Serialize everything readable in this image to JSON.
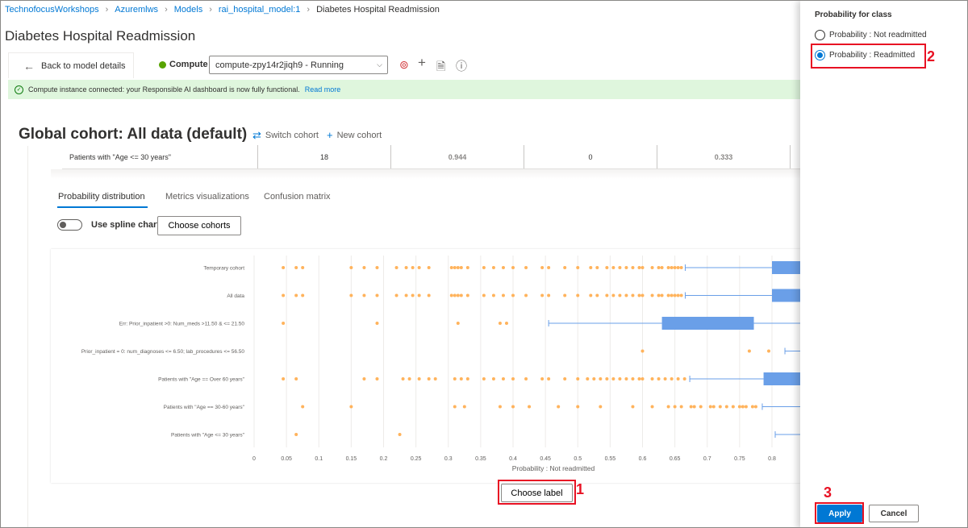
{
  "breadcrumb": [
    "TechnofocusWorkshops",
    "Azuremlws",
    "Models",
    "rai_hospital_model:1",
    "Diabetes Hospital Readmission"
  ],
  "page_title": "Diabetes Hospital Readmission",
  "toolbar": {
    "back_label": "Back to model details",
    "compute_label": "Compute",
    "compute_value": "compute-zpy14r2jiqh9 - Running",
    "status_color": "#57a300"
  },
  "info_bar": {
    "text": "Compute instance connected: your Responsible AI dashboard is now fully functional.",
    "link": "Read more"
  },
  "cohort": {
    "title": "Global cohort: All data (default)",
    "switch_label": "Switch cohort",
    "new_label": "New cohort"
  },
  "table_row": {
    "name": "Patients with \"Age <= 30 years\"",
    "values": [
      "18",
      "0.944",
      "0",
      "0.333"
    ]
  },
  "tabs": [
    "Probability distribution",
    "Metrics visualizations",
    "Confusion matrix"
  ],
  "controls": {
    "spline_label": "Use spline chart",
    "choose_cohorts": "Choose cohorts",
    "choose_label": "Choose label"
  },
  "chart_data": {
    "type": "box",
    "xlabel": "Probability : Not readmitted",
    "xlim": [
      0,
      0.8
    ],
    "x_ticks": [
      0,
      0.05,
      0.1,
      0.15,
      0.2,
      0.25,
      0.3,
      0.35,
      0.4,
      0.45,
      0.5,
      0.55,
      0.6,
      0.65,
      0.7,
      0.75,
      0.8
    ],
    "outlier_color": "#ffb35c",
    "box_color": "#6a9fe8",
    "categories": [
      "Temporary cohort",
      "All data",
      "Err: Prior_inpatient >0: Num_meds >11.50 & <= 21.50",
      "Prior_inpatient = 0: num_diagnoses <= 6.50; lab_procedures <= 56.50",
      "Patients with \"Age == Over 60 years\"",
      "Patients with \"Age == 30-60 years\"",
      "Patients with \"Age <= 30 years\""
    ],
    "series": [
      {
        "whisker_low": 0.666,
        "box_q1": 0.8,
        "box_q3": null,
        "outliers": [
          0.045,
          0.065,
          0.075,
          0.15,
          0.17,
          0.19,
          0.22,
          0.235,
          0.245,
          0.255,
          0.27,
          0.305,
          0.31,
          0.315,
          0.32,
          0.33,
          0.355,
          0.37,
          0.385,
          0.4,
          0.42,
          0.445,
          0.455,
          0.48,
          0.5,
          0.52,
          0.53,
          0.545,
          0.555,
          0.565,
          0.575,
          0.585,
          0.595,
          0.6,
          0.615,
          0.625,
          0.63,
          0.64,
          0.645,
          0.65,
          0.655,
          0.66
        ]
      },
      {
        "whisker_low": 0.666,
        "box_q1": 0.8,
        "box_q3": null,
        "outliers": [
          0.045,
          0.065,
          0.075,
          0.15,
          0.17,
          0.19,
          0.22,
          0.235,
          0.245,
          0.255,
          0.27,
          0.305,
          0.31,
          0.315,
          0.32,
          0.33,
          0.355,
          0.37,
          0.385,
          0.4,
          0.42,
          0.445,
          0.455,
          0.48,
          0.5,
          0.52,
          0.53,
          0.545,
          0.555,
          0.565,
          0.575,
          0.585,
          0.595,
          0.6,
          0.615,
          0.625,
          0.63,
          0.64,
          0.645,
          0.65,
          0.655,
          0.66
        ]
      },
      {
        "whisker_low": 0.455,
        "box_q1": 0.63,
        "box_q3": 0.772,
        "whisker_high": null,
        "outliers": [
          0.045,
          0.19,
          0.315,
          0.38,
          0.39
        ]
      },
      {
        "whisker_low": 0.82,
        "box_q1": null,
        "box_q3": null,
        "outliers": [
          0.6,
          0.765,
          0.795
        ]
      },
      {
        "whisker_low": 0.673,
        "box_q1": 0.787,
        "box_q3": null,
        "outliers": [
          0.045,
          0.065,
          0.17,
          0.19,
          0.23,
          0.24,
          0.255,
          0.27,
          0.28,
          0.31,
          0.32,
          0.33,
          0.355,
          0.37,
          0.385,
          0.4,
          0.42,
          0.445,
          0.455,
          0.48,
          0.5,
          0.515,
          0.525,
          0.535,
          0.545,
          0.555,
          0.565,
          0.575,
          0.585,
          0.595,
          0.6,
          0.615,
          0.625,
          0.635,
          0.645,
          0.655,
          0.665
        ]
      },
      {
        "whisker_low": 0.785,
        "box_q1": null,
        "box_q3": null,
        "outliers": [
          0.075,
          0.15,
          0.31,
          0.325,
          0.38,
          0.4,
          0.425,
          0.47,
          0.5,
          0.535,
          0.585,
          0.615,
          0.64,
          0.65,
          0.66,
          0.675,
          0.68,
          0.69,
          0.705,
          0.71,
          0.72,
          0.73,
          0.74,
          0.75,
          0.755,
          0.76,
          0.77,
          0.775
        ]
      },
      {
        "whisker_low": 0.805,
        "box_q1": null,
        "box_q3": null,
        "outliers": [
          0.065,
          0.225
        ]
      }
    ]
  },
  "panel": {
    "title": "Probability for class",
    "options": [
      "Probability : Not readmitted",
      "Probability : Readmitted"
    ],
    "selected": 1,
    "apply": "Apply",
    "cancel": "Cancel"
  },
  "annotations": [
    "1",
    "2",
    "3"
  ]
}
